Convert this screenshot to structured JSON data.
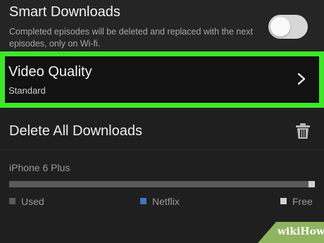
{
  "smart_downloads": {
    "title": "Smart Downloads",
    "description": "Completed episodes will be deleted and replaced with the next episodes, only on Wi-fi.",
    "toggle_on": false
  },
  "video_quality": {
    "title": "Video Quality",
    "value": "Standard",
    "chevron_icon": "chevron-right-icon",
    "highlight_color": "#3ee62a"
  },
  "delete_all": {
    "title": "Delete All Downloads",
    "icon": "trash-icon"
  },
  "storage": {
    "device": "iPhone 6 Plus",
    "used_fraction": 0.98,
    "netflix_fraction": 0.0,
    "free_fraction": 0.02,
    "legend": {
      "used": "Used",
      "netflix": "Netflix",
      "free": "Free"
    },
    "colors": {
      "used": "#5a5a5a",
      "netflix": "#3b76c4",
      "free": "#d2d2d2"
    }
  },
  "watermark": {
    "text": "wikiHow"
  }
}
